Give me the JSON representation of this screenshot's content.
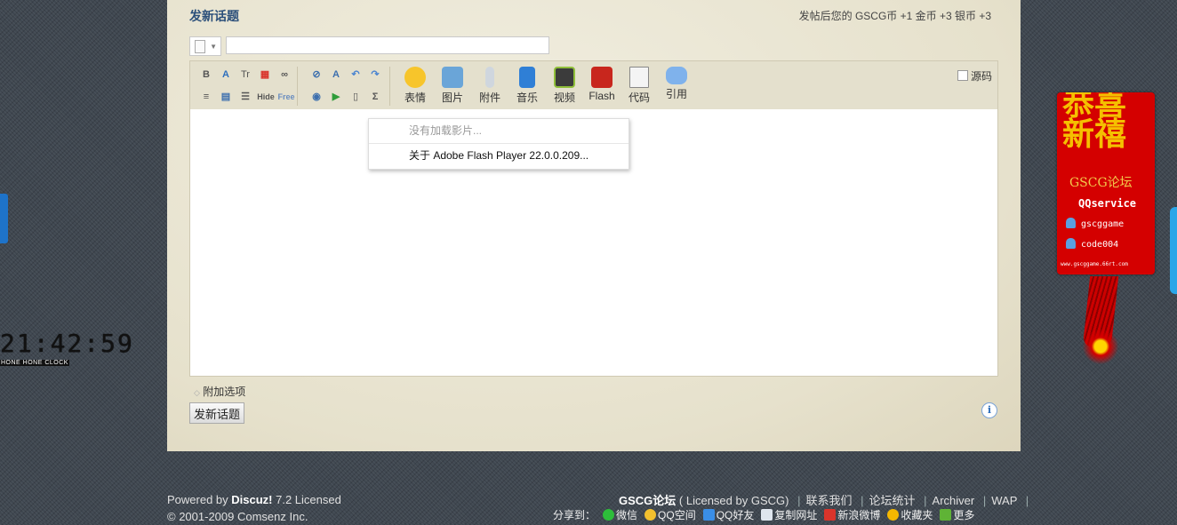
{
  "post": {
    "title": "发新话题",
    "credit_info": "发帖后您的 GSCG币 +1  金币 +3  银币 +3",
    "subject_value": "",
    "source_label": "源码",
    "attach_options": "附加选项",
    "submit_label": "发新话题"
  },
  "toolbar": {
    "small_buttons": [
      {
        "name": "bold",
        "glyph": "B"
      },
      {
        "name": "font-color",
        "glyph": "A"
      },
      {
        "name": "font-size",
        "glyph": "Tr"
      },
      {
        "name": "color-palette",
        "glyph": "▦"
      },
      {
        "name": "link",
        "glyph": "∞"
      },
      {
        "name": "unlink",
        "glyph": "⊘"
      },
      {
        "name": "remove-format",
        "glyph": "A"
      },
      {
        "name": "undo",
        "glyph": "↶"
      },
      {
        "name": "redo",
        "glyph": "↷"
      },
      {
        "name": "align",
        "glyph": "≡"
      },
      {
        "name": "table",
        "glyph": "▤"
      },
      {
        "name": "list",
        "glyph": "☰"
      },
      {
        "name": "hide",
        "glyph": "Hide"
      },
      {
        "name": "free",
        "glyph": "Free"
      },
      {
        "name": "insert-image",
        "glyph": "◉"
      },
      {
        "name": "insert-media",
        "glyph": "▶"
      },
      {
        "name": "page",
        "glyph": "▯"
      },
      {
        "name": "formula",
        "glyph": "Σ"
      }
    ],
    "big_buttons": [
      {
        "name": "emoticon",
        "label": "表情",
        "color": "#f7c52b"
      },
      {
        "name": "image",
        "label": "图片",
        "color": "#6aa5d8"
      },
      {
        "name": "attachment",
        "label": "附件",
        "color": "#cfd6de"
      },
      {
        "name": "music",
        "label": "音乐",
        "color": "#2f7fd6"
      },
      {
        "name": "video",
        "label": "视频",
        "color": "#3b3b3b"
      },
      {
        "name": "flash",
        "label": "Flash",
        "color": "#c8261d"
      },
      {
        "name": "code",
        "label": "代码",
        "color": "#f4f4f4"
      },
      {
        "name": "quote",
        "label": "引用",
        "color": "#7fb2ec"
      }
    ]
  },
  "context_menu": {
    "items": [
      "没有加载影片...",
      "关于 Adobe Flash Player 22.0.0.209..."
    ]
  },
  "footer": {
    "powered_prefix": "Powered by ",
    "powered_brand": "Discuz!",
    "powered_suffix": " 7.2 Licensed",
    "copyright": "© 2001-2009 Comsenz Inc.",
    "site_name": "GSCG论坛",
    "licensed": " ( Licensed by GSCG)",
    "links": [
      "联系我们",
      "论坛统计",
      "Archiver",
      "WAP"
    ]
  },
  "share": {
    "label": "分享到：",
    "items": [
      {
        "name": "wechat",
        "label": "微信",
        "color": "#2dbd3a"
      },
      {
        "name": "qzone",
        "label": "QQ空间",
        "color": "#f2c02e"
      },
      {
        "name": "qq-friend",
        "label": "QQ好友",
        "color": "#3a8ee6"
      },
      {
        "name": "copy-url",
        "label": "复制网址",
        "color": "#dfe6ee"
      },
      {
        "name": "weibo",
        "label": "新浪微博",
        "color": "#d9342b"
      },
      {
        "name": "favorite",
        "label": "收藏夹",
        "color": "#f5b800"
      },
      {
        "name": "more",
        "label": "更多",
        "color": "#5fb336"
      }
    ]
  },
  "clock": {
    "time": "21:42:59",
    "label": "HONE HONE CLOCK"
  },
  "qq_widget": {
    "greeting": "恭喜新禧",
    "forum": "GSCG论坛",
    "service": "QQservice",
    "contacts": [
      "gscggame",
      "code004"
    ],
    "url": "www.gscggame.66rt.com"
  }
}
